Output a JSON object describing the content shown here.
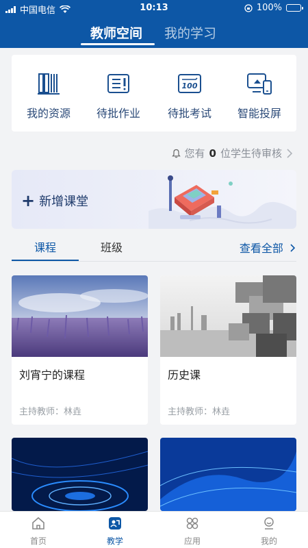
{
  "status": {
    "carrier": "中国电信",
    "time": "10:13",
    "battery": "100%"
  },
  "header": {
    "tabs": [
      {
        "label": "教师空间"
      },
      {
        "label": "我的学习"
      }
    ]
  },
  "quick_actions": [
    {
      "label": "我的资源",
      "icon": "books-icon"
    },
    {
      "label": "待批作业",
      "icon": "homework-icon"
    },
    {
      "label": "待批考试",
      "icon": "exam-icon"
    },
    {
      "label": "智能投屏",
      "icon": "cast-icon"
    }
  ],
  "notice": {
    "prefix": "您有",
    "count": "0",
    "suffix": "位学生待审核"
  },
  "banner": {
    "add_label": "新增课堂"
  },
  "course_tabs": {
    "tabs": [
      {
        "label": "课程"
      },
      {
        "label": "班级"
      }
    ],
    "view_all": "查看全部"
  },
  "courses": [
    {
      "title": "刘宵宁的课程",
      "teacher": "主持教师：林垚"
    },
    {
      "title": "历史课",
      "teacher": "主持教师：林垚"
    },
    {
      "title": "",
      "teacher": ""
    },
    {
      "title": "",
      "teacher": ""
    }
  ],
  "bottom_nav": [
    {
      "label": "首页"
    },
    {
      "label": "教学"
    },
    {
      "label": "应用"
    },
    {
      "label": "我的"
    }
  ],
  "colors": {
    "primary": "#0d57a6",
    "background": "#f2f3f5"
  }
}
